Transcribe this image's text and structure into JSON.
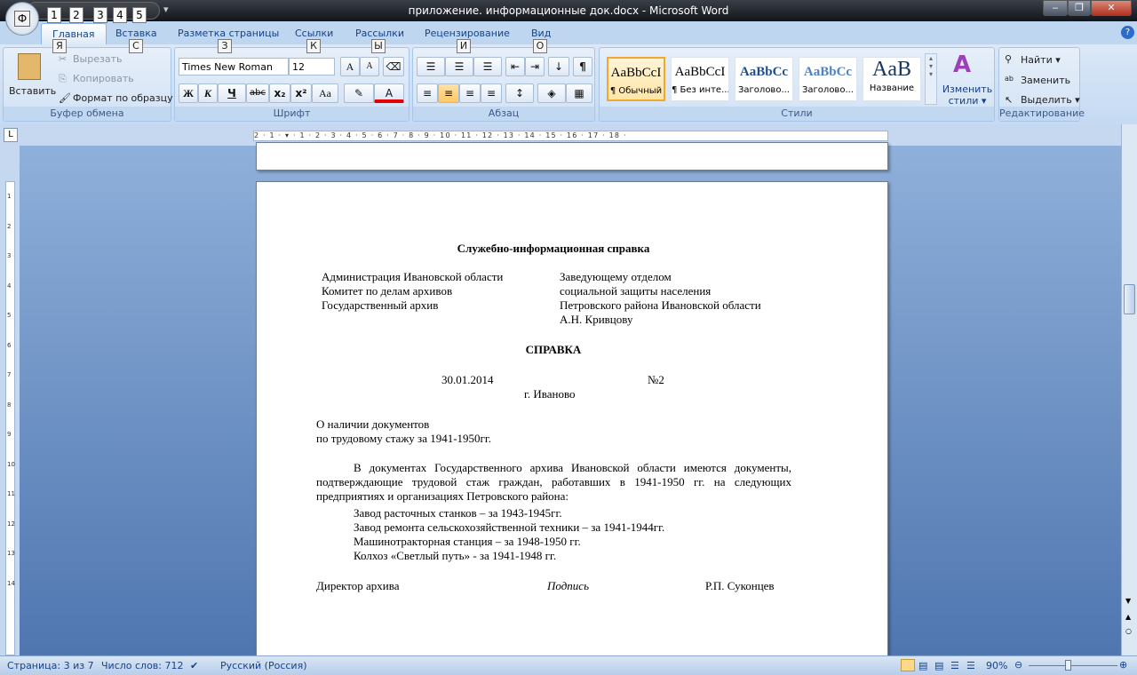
{
  "window": {
    "title": "приложение. информационные док.docx - Microsoft Word",
    "minimize": "‒",
    "restore": "❐",
    "close": "✕"
  },
  "office_button": {
    "key": "Ф"
  },
  "qat": {
    "keys": [
      "1",
      "2",
      "3",
      "4",
      "5"
    ],
    "customize": "▾"
  },
  "tabs": [
    {
      "label": "Главная",
      "key": "Я"
    },
    {
      "label": "Вставка",
      "key": "С"
    },
    {
      "label": "Разметка страницы",
      "key": "З"
    },
    {
      "label": "Ссылки",
      "key": "К"
    },
    {
      "label": "Рассылки",
      "key": "Ы"
    },
    {
      "label": "Рецензирование",
      "key": "И"
    },
    {
      "label": "Вид",
      "key": "О"
    }
  ],
  "help": "?",
  "clipboard": {
    "label": "Буфер обмена",
    "paste": "Вставить",
    "cut": "Вырезать",
    "copy": "Копировать",
    "format_painter": "Формат по образцу"
  },
  "font": {
    "label": "Шрифт",
    "name": "Times New Roman",
    "size": "12",
    "bold": "Ж",
    "italic": "К",
    "underline": "Ч",
    "strike": "abc",
    "sub": "x₂",
    "sup": "x²",
    "case": "Aa",
    "grow": "A",
    "shrink": "A",
    "font_color": "#e00000"
  },
  "paragraph": {
    "label": "Абзац",
    "pilcrow": "¶"
  },
  "styles": {
    "label": "Стили",
    "items": [
      {
        "sample": "AaBbCcI",
        "name": "¶ Обычный"
      },
      {
        "sample": "AaBbCcI",
        "name": "¶ Без инте..."
      },
      {
        "sample": "AaBbCc",
        "name": "Заголово..."
      },
      {
        "sample": "AaBbCc",
        "name": "Заголово..."
      },
      {
        "sample": "AaB",
        "name": "Название"
      }
    ],
    "change": "Изменить стили ▾"
  },
  "editing": {
    "label": "Редактирование",
    "find": "Найти ▾",
    "replace": "Заменить",
    "select": "Выделить ▾"
  },
  "ruler": {
    "ticks": "2 · 1 · ▾ · 1 · 2 · 3 · 4 · 5 · 6 · 7 · 8 · 9 · 10 · 11 · 12 · 13 · 14 · 15 · 16 · 17 · 18 ·",
    "vticks": [
      "1",
      "2",
      "3",
      "4",
      "5",
      "6",
      "7",
      "8",
      "9",
      "10",
      "11",
      "12",
      "13",
      "14"
    ]
  },
  "document": {
    "heading": "Служебно-информационная  справка",
    "left_block": [
      "Администрация Ивановской области",
      "Комитет по делам архивов",
      "Государственный архив"
    ],
    "right_block": [
      "Заведующему отделом",
      "социальной защиты населения",
      "Петровского района Ивановской области",
      "А.Н. Кривцову"
    ],
    "title": "СПРАВКА",
    "date": "30.01.2014",
    "number": "№2",
    "city": "г. Иваново",
    "subject": [
      "О наличии документов",
      "по трудовому стажу за 1941-1950гг."
    ],
    "body": "В документах Государственного архива Ивановской области имеются документы, подтверждающие трудовой стаж граждан, работавших в 1941-1950 гг. на следующих предприятиях и организациях Петровского района:",
    "list": [
      "Завод расточных станков – за 1943-1945гг.",
      "Завод ремонта сельскохозяйственной  техники – за 1941-1944гг.",
      "Машинотракторная станция – за 1948-1950 гг.",
      "Колхоз «Светлый путь» - за 1941-1948 гг."
    ],
    "sign_role": "Директор архива",
    "sign": "Подпись",
    "sign_name": "Р.П. Суконцев"
  },
  "status": {
    "page": "Страница: 3 из 7",
    "words": "Число слов: 712",
    "language": "Русский (Россия)",
    "zoom": "90%",
    "zoom_level_percent": 90
  }
}
